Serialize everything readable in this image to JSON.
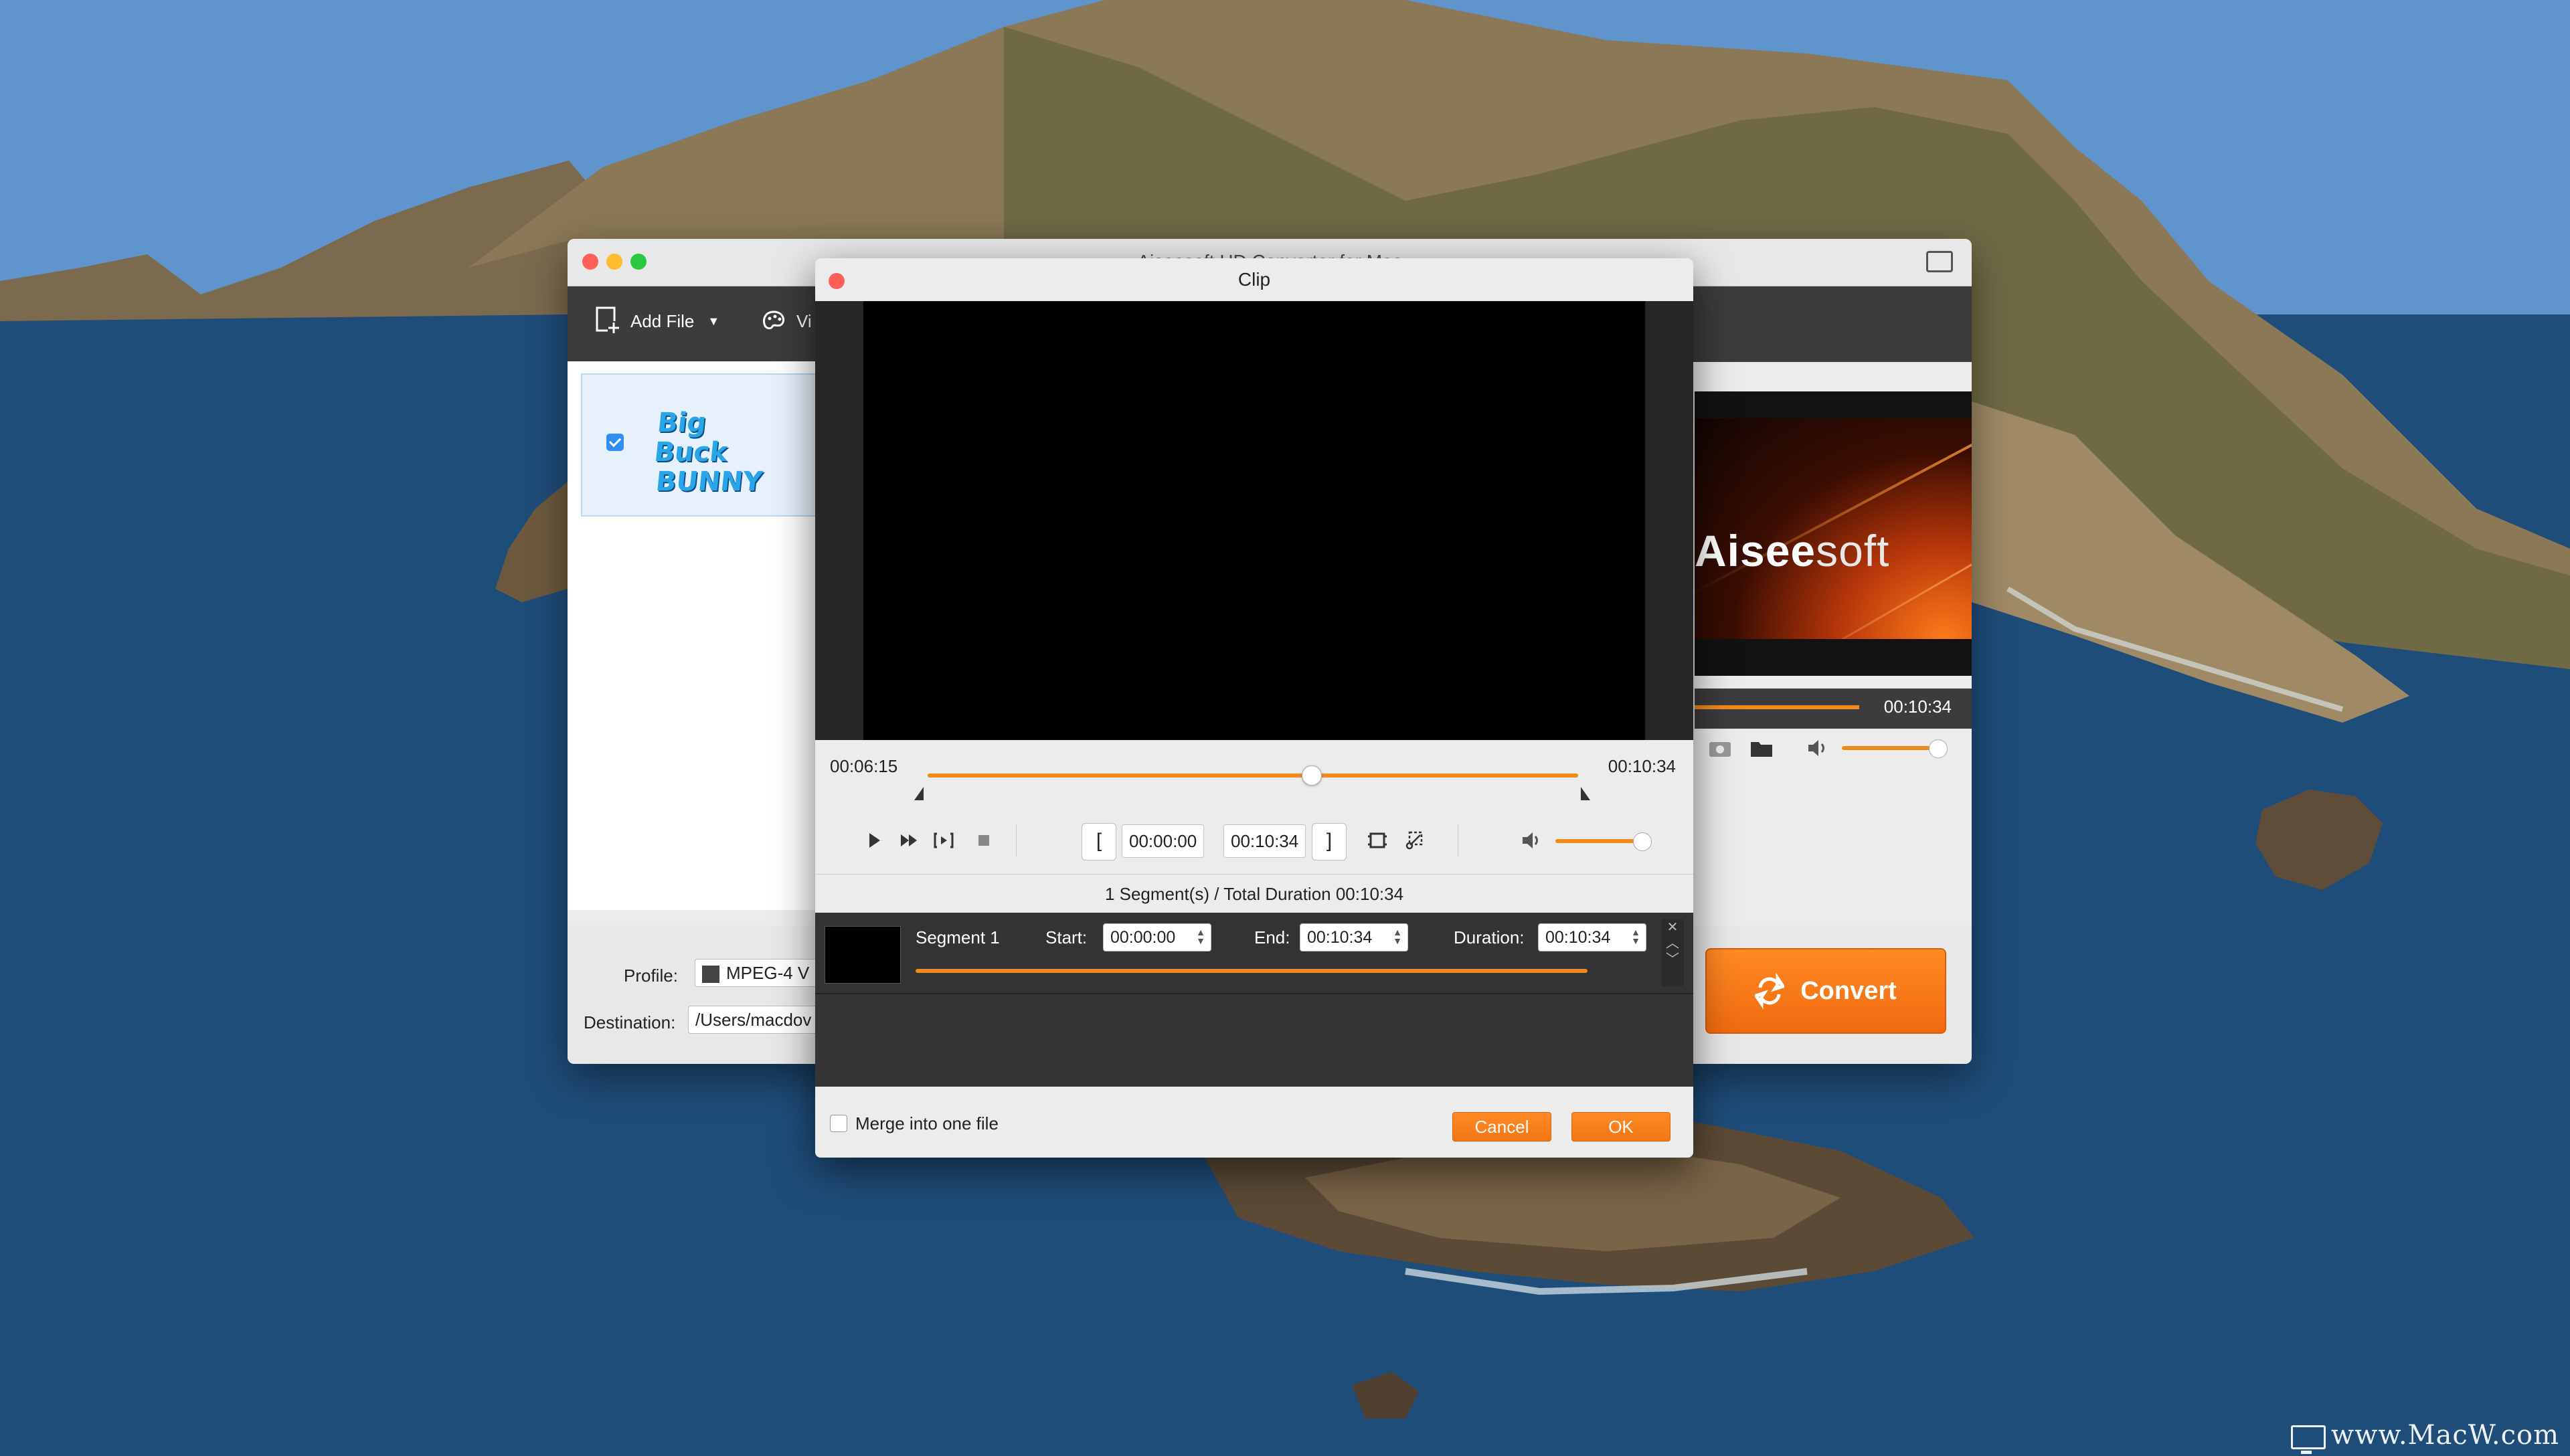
{
  "main_window": {
    "title": "Aiseesoft HD Converter for Mac",
    "toolbar": {
      "add_file_label": "Add File",
      "video_label": "Vi"
    },
    "file_item": {
      "thumbnail_text_1": "Big Buck",
      "thumbnail_text_2": "BUNNY"
    },
    "profile": {
      "label": "Profile:",
      "value": "MPEG-4 V"
    },
    "destination": {
      "label": "Destination:",
      "value": "/Users/macdov"
    },
    "preview": {
      "brand_bold": "Aisee",
      "brand_light": "soft",
      "time": "00:10:34",
      "progress_fraction": 0.6
    },
    "convert_label": "Convert"
  },
  "clip_dialog": {
    "title": "Clip",
    "current_time": "00:06:15",
    "total_time": "00:10:34",
    "playhead_fraction": 0.59,
    "start_time": "00:00:00",
    "end_time": "00:10:34",
    "volume_fraction": 0.95,
    "summary": "1 Segment(s) / Total Duration 00:10:34",
    "segment": {
      "name": "Segment 1",
      "start_label": "Start:",
      "start_value": "00:00:00",
      "end_label": "End:",
      "end_value": "00:10:34",
      "duration_label": "Duration:",
      "duration_value": "00:10:34"
    },
    "merge_label": "Merge into one file",
    "cancel_label": "Cancel",
    "ok_label": "OK"
  },
  "watermark": "www.MacW.com",
  "colors": {
    "accent": "#f08a1e",
    "dark_panel": "#3a3a3c",
    "close": "#fe5f57"
  }
}
